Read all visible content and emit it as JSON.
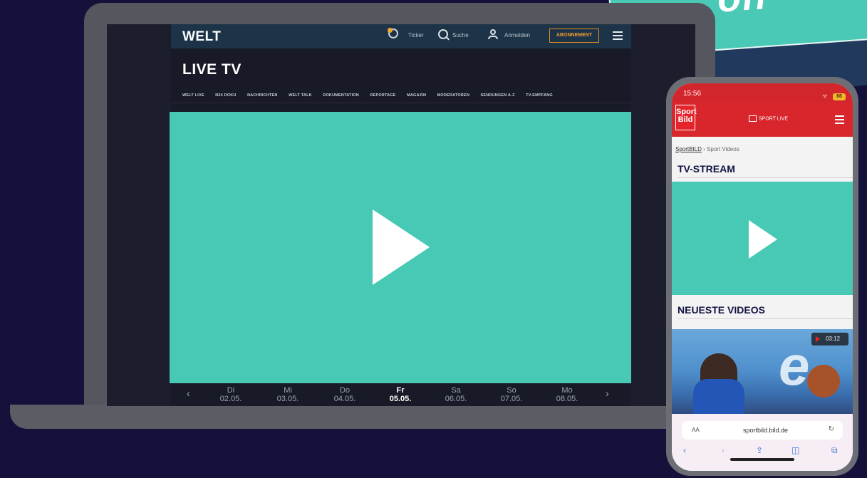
{
  "banner": {
    "text": "on"
  },
  "laptop": {
    "welt": {
      "logo": "WELT",
      "ticker_label": "Ticker",
      "search_label": "Suche",
      "login_label": "Anmelden",
      "subscribe_label": "ABONNEMENT",
      "page_title": "LIVE TV",
      "nav_items": [
        "WELT LIVE",
        "N24 DOKU",
        "NACHRICHTEN",
        "WELT TALK",
        "DOKUMENTATION",
        "REPORTAGE",
        "MAGAZIN",
        "MODERATOREN",
        "SENDUNGEN A-Z",
        "TV-EMPFANG"
      ],
      "dates": [
        {
          "day": "Di",
          "date": "02.05."
        },
        {
          "day": "Mi",
          "date": "03.05."
        },
        {
          "day": "Do",
          "date": "04.05."
        },
        {
          "day": "Fr",
          "date": "05.05."
        },
        {
          "day": "Sa",
          "date": "06.05."
        },
        {
          "day": "So",
          "date": "07.05."
        },
        {
          "day": "Mo",
          "date": "08.05."
        }
      ],
      "active_date_index": 3,
      "prev_arrow": "‹",
      "next_arrow": "›"
    }
  },
  "phone": {
    "status_time": "15:56",
    "battery": "66",
    "logo_top": "Sport",
    "logo_bottom": "Bild",
    "live_label": "SPORT LIVE",
    "breadcrumb_home": "SportBILD",
    "breadcrumb_sep": "›",
    "breadcrumb_current": "Sport Videos",
    "stream_title": "TV-STREAM",
    "latest_title": "NEUESTE VIDEOS",
    "thumb_text": "e",
    "video_duration": "03:12",
    "url_aa": "AA",
    "url": "sportbild.bild.de"
  },
  "colors": {
    "background": "#14123a",
    "accent_teal": "#48c9b6",
    "welt_header": "#1d3448",
    "sportbild_red": "#d8262c",
    "subscribe_orange": "#e08a20"
  }
}
